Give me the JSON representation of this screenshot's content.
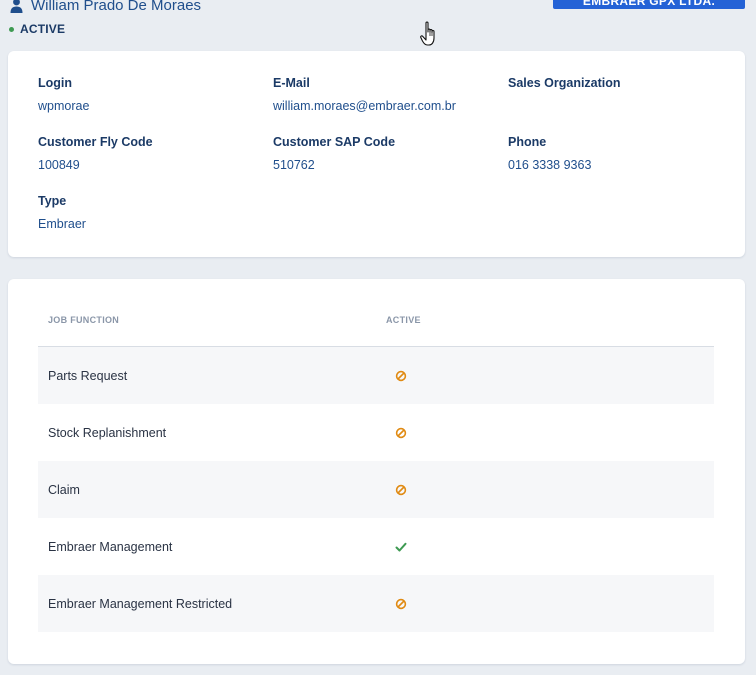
{
  "header": {
    "user_name": "William Prado De Moraes",
    "status": "ACTIVE",
    "organization_button": "EMBRAER GPX LTDA."
  },
  "details": {
    "login_label": "Login",
    "login_value": "wpmorae",
    "email_label": "E-Mail",
    "email_value": "william.moraes@embraer.com.br",
    "sales_org_label": "Sales Organization",
    "sales_org_value": "",
    "fly_code_label": "Customer Fly Code",
    "fly_code_value": "100849",
    "sap_code_label": "Customer SAP Code",
    "sap_code_value": "510762",
    "phone_label": "Phone",
    "phone_value": "016 3338 9363",
    "type_label": "Type",
    "type_value": "Embraer"
  },
  "job_functions": {
    "col_function": "JOB FUNCTION",
    "col_active": "ACTIVE",
    "rows": [
      {
        "name": "Parts Request",
        "active": "blocked-icon"
      },
      {
        "name": "Stock Replanishment",
        "active": "blocked-icon"
      },
      {
        "name": "Claim",
        "active": "blocked-icon"
      },
      {
        "name": "Embraer Management",
        "active": "check-icon"
      },
      {
        "name": "Embraer Management Restricted",
        "active": "blocked-icon"
      }
    ]
  },
  "colors": {
    "accent": "#2462d6",
    "blocked": "#e08a12",
    "check": "#3e9a52"
  }
}
